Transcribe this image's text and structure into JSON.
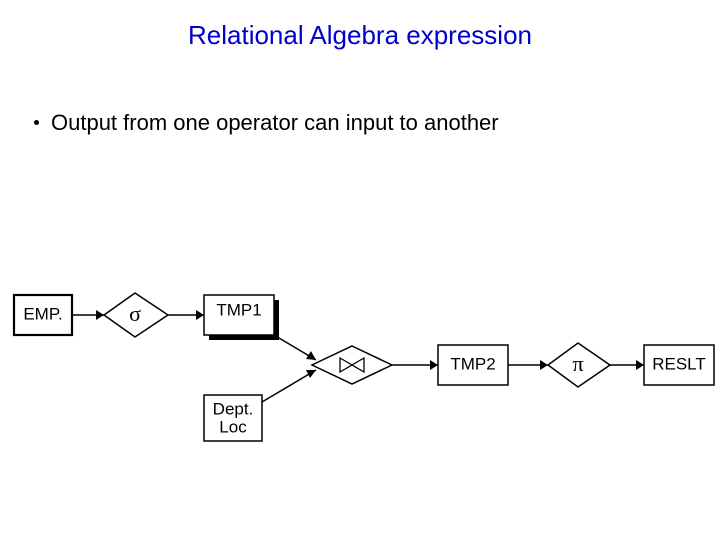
{
  "title": "Relational Algebra expression",
  "bullet": "Output from one operator can input to another",
  "nodes": {
    "emp": "EMP.",
    "sigma": "σ",
    "tmp1": "TMP1",
    "deptloc_line1": "Dept.",
    "deptloc_line2": "Loc",
    "join": "⋈",
    "tmp2": "TMP2",
    "pi": "π",
    "reslt": "RESLT"
  }
}
